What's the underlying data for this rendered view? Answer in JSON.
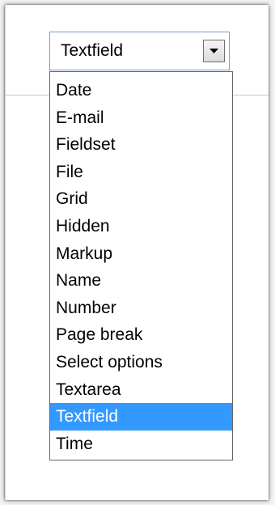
{
  "select": {
    "value": "Textfield",
    "arrow_icon": "chevron-down-icon",
    "options": [
      "Date",
      "E-mail",
      "Fieldset",
      "File",
      "Grid",
      "Hidden",
      "Markup",
      "Name",
      "Number",
      "Page break",
      "Select options",
      "Textarea",
      "Textfield",
      "Time"
    ],
    "highlighted_option": "Textfield"
  },
  "colors": {
    "highlight": "#3399ff",
    "highlight_text": "#ffffff",
    "select_border": "#7a9cc6"
  }
}
